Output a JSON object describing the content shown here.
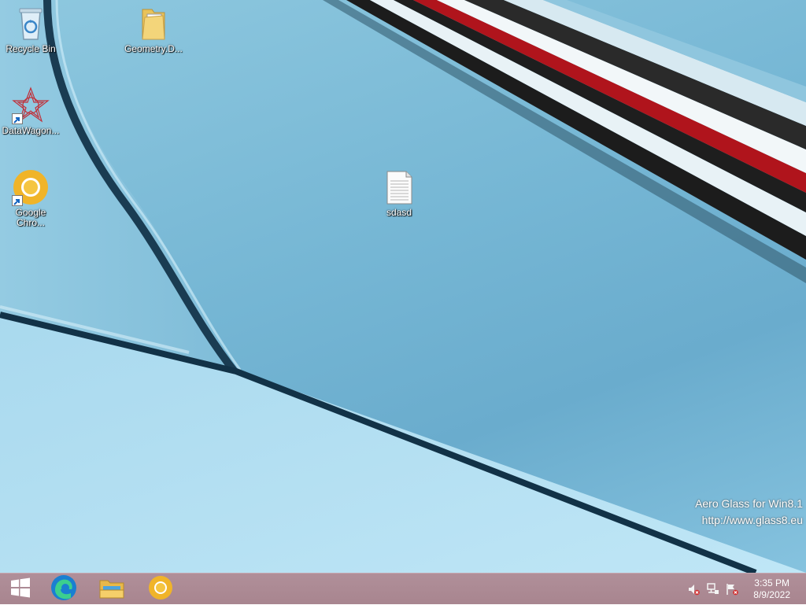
{
  "desktop": {
    "icons": [
      {
        "label": "Recycle Bin",
        "icon": "recycle-bin-icon"
      },
      {
        "label": "Geometry.D...",
        "icon": "folder-icon"
      },
      {
        "label": "DataWagon...",
        "icon": "datawagon-icon"
      },
      {
        "label": "Google Chro...",
        "icon": "chrome-icon"
      },
      {
        "label": "sdasd",
        "icon": "text-document-icon"
      }
    ],
    "watermark": {
      "line1": "Aero Glass for Win8.1",
      "line2": "http://www.glass8.eu"
    }
  },
  "taskbar": {
    "buttons": [
      {
        "icon": "windows-start-icon"
      },
      {
        "icon": "edge-icon"
      },
      {
        "icon": "file-explorer-icon"
      },
      {
        "icon": "chrome-icon"
      }
    ],
    "tray": {
      "icons": [
        "speaker-muted-icon",
        "network-icon",
        "action-center-flag-icon"
      ]
    },
    "clock": {
      "time": "3:35 PM",
      "date": "8/9/2022"
    }
  },
  "colors": {
    "taskbar": "#a8858f",
    "wallpaper_accent_red": "#b0141c"
  }
}
